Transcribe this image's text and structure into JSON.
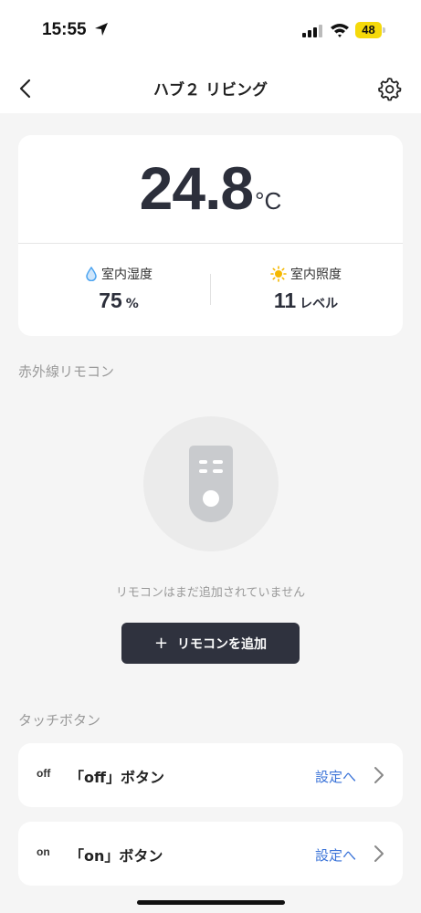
{
  "status_bar": {
    "time": "15:55",
    "battery": "48"
  },
  "nav": {
    "title": "ハブ２ リビング"
  },
  "climate": {
    "temperature": "24.8",
    "temperature_unit": "°C",
    "humidity_label": "室内湿度",
    "humidity_value": "75",
    "humidity_unit": "%",
    "light_label": "室内照度",
    "light_value": "11",
    "light_unit": "レベル"
  },
  "ir_remote": {
    "section_title": "赤外線リモコン",
    "empty_message": "リモコンはまだ追加されていません",
    "add_button_plus": "+",
    "add_button_label": "リモコンを追加"
  },
  "touch_buttons": {
    "section_title": "タッチボタン",
    "items": [
      {
        "icon_text": "off",
        "label": "「off」ボタン",
        "link": "設定へ"
      },
      {
        "icon_text": "on",
        "label": "「on」ボタン",
        "link": "設定へ"
      }
    ]
  },
  "colors": {
    "accent_blue": "#3a73d8",
    "dark_button": "#2f323e",
    "humidity_icon": "#4aa3f0",
    "sun_icon": "#f5b800"
  }
}
